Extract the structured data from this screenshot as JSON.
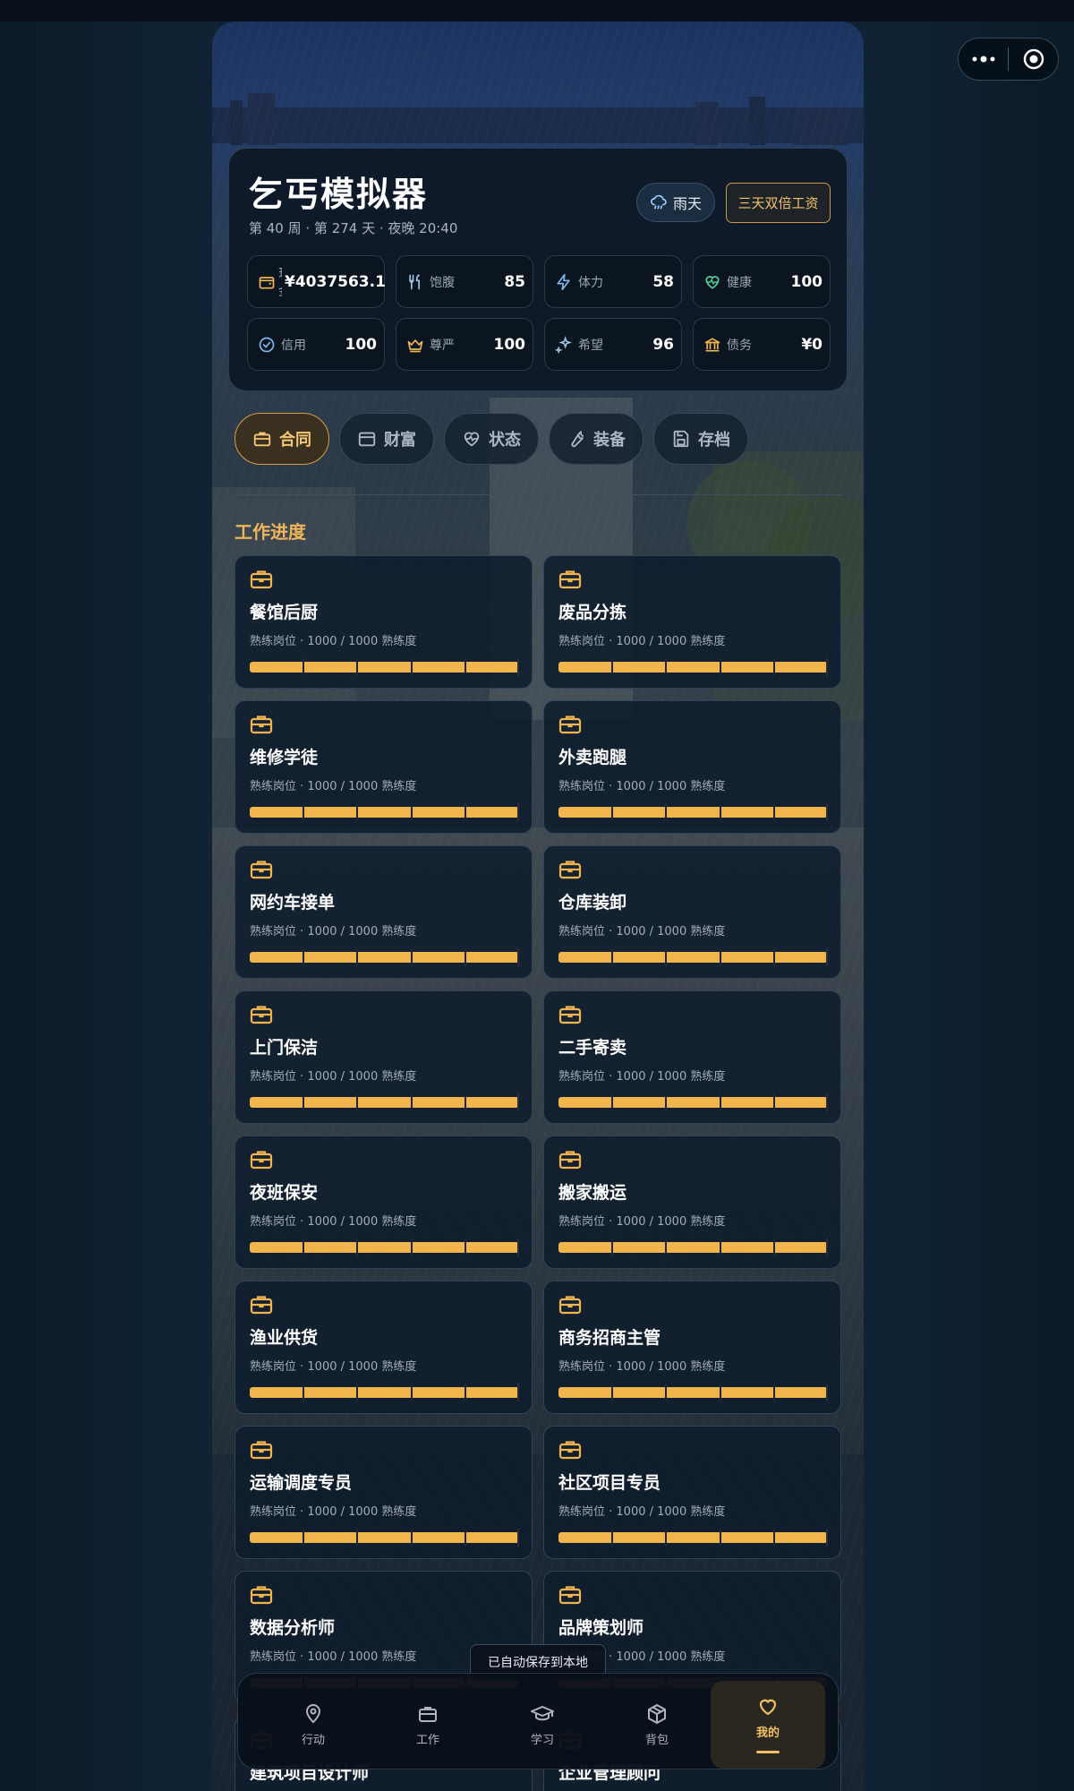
{
  "app": {
    "title": "乞丐模拟器",
    "subtitle": "第 40 周 · 第 274 天 · 夜晚 20:40",
    "weather": "雨天",
    "bonus_badge": "三天双倍工资"
  },
  "stats": [
    {
      "icon": "wallet-icon",
      "label": "现金",
      "value": "¥4037563.1"
    },
    {
      "icon": "utensils-icon",
      "label": "饱腹",
      "value": "85"
    },
    {
      "icon": "lightning-icon",
      "label": "体力",
      "value": "58"
    },
    {
      "icon": "heart-pulse-icon",
      "label": "健康",
      "value": "100"
    },
    {
      "icon": "check-circle-icon",
      "label": "信用",
      "value": "100"
    },
    {
      "icon": "crown-icon",
      "label": "尊严",
      "value": "100"
    },
    {
      "icon": "sparkle-icon",
      "label": "希望",
      "value": "96"
    },
    {
      "icon": "bank-icon",
      "label": "债务",
      "value": "¥0"
    }
  ],
  "tabs": [
    {
      "label": "合同",
      "icon": "briefcase-icon",
      "active": true
    },
    {
      "label": "财富",
      "icon": "wallet-icon",
      "active": false
    },
    {
      "label": "状态",
      "icon": "heart-pulse-icon",
      "active": false
    },
    {
      "label": "装备",
      "icon": "wrench-icon",
      "active": false
    },
    {
      "label": "存档",
      "icon": "save-icon",
      "active": false
    }
  ],
  "section_title": "工作进度",
  "jobs": [
    {
      "name": "餐馆后厨",
      "meta": "熟练岗位 · 1000 / 1000 熟练度",
      "progress": 1.0
    },
    {
      "name": "废品分拣",
      "meta": "熟练岗位 · 1000 / 1000 熟练度",
      "progress": 1.0
    },
    {
      "name": "维修学徒",
      "meta": "熟练岗位 · 1000 / 1000 熟练度",
      "progress": 1.0
    },
    {
      "name": "外卖跑腿",
      "meta": "熟练岗位 · 1000 / 1000 熟练度",
      "progress": 1.0
    },
    {
      "name": "网约车接单",
      "meta": "熟练岗位 · 1000 / 1000 熟练度",
      "progress": 1.0
    },
    {
      "name": "仓库装卸",
      "meta": "熟练岗位 · 1000 / 1000 熟练度",
      "progress": 1.0
    },
    {
      "name": "上门保洁",
      "meta": "熟练岗位 · 1000 / 1000 熟练度",
      "progress": 1.0
    },
    {
      "name": "二手寄卖",
      "meta": "熟练岗位 · 1000 / 1000 熟练度",
      "progress": 1.0
    },
    {
      "name": "夜班保安",
      "meta": "熟练岗位 · 1000 / 1000 熟练度",
      "progress": 1.0
    },
    {
      "name": "搬家搬运",
      "meta": "熟练岗位 · 1000 / 1000 熟练度",
      "progress": 1.0
    },
    {
      "name": "渔业供货",
      "meta": "熟练岗位 · 1000 / 1000 熟练度",
      "progress": 1.0
    },
    {
      "name": "商务招商主管",
      "meta": "熟练岗位 · 1000 / 1000 熟练度",
      "progress": 1.0
    },
    {
      "name": "运输调度专员",
      "meta": "熟练岗位 · 1000 / 1000 熟练度",
      "progress": 1.0
    },
    {
      "name": "社区项目专员",
      "meta": "熟练岗位 · 1000 / 1000 熟练度",
      "progress": 1.0
    },
    {
      "name": "数据分析师",
      "meta": "熟练岗位 · 1000 / 1000 熟练度",
      "progress": 1.0
    },
    {
      "name": "品牌策划师",
      "meta": "熟练岗位 · 1000 / 1000 熟练度",
      "progress": 1.0
    },
    {
      "name": "建筑项目设计师",
      "meta": "",
      "progress": 1.0
    },
    {
      "name": "企业管理顾问",
      "meta": "",
      "progress": 1.0
    }
  ],
  "toast": "已自动保存到本地",
  "nav": [
    {
      "label": "行动",
      "icon": "location-pin-icon",
      "active": false
    },
    {
      "label": "工作",
      "icon": "briefcase-icon",
      "active": false
    },
    {
      "label": "学习",
      "icon": "graduation-cap-icon",
      "active": false
    },
    {
      "label": "背包",
      "icon": "package-icon",
      "active": false
    },
    {
      "label": "我的",
      "icon": "heart-icon",
      "active": true
    }
  ],
  "colors": {
    "accent": "#f2b54e",
    "accent_border": "#d79d45",
    "card_bg": "#0e1c2c",
    "text": "#ffffff",
    "muted": "#a3adb8"
  }
}
